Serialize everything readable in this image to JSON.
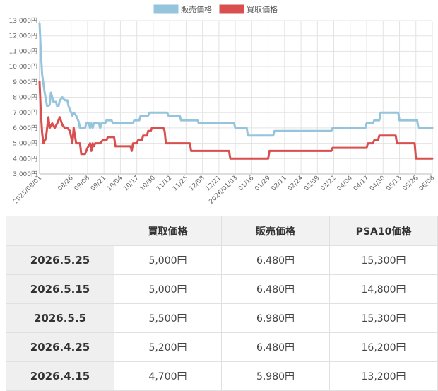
{
  "chart_data": {
    "type": "line",
    "legend_position": "top",
    "x_tick_labels": [
      "2025/08/01",
      "08/26",
      "09/08",
      "09/21",
      "10/04",
      "10/17",
      "10/30",
      "11/12",
      "11/25",
      "12/08",
      "12/21",
      "2026/01/03",
      "01/16",
      "01/29",
      "02/11",
      "02/24",
      "03/09",
      "03/22",
      "04/04",
      "04/17",
      "04/30",
      "05/13",
      "05/26",
      "06/08"
    ],
    "ylim": [
      3000,
      13000
    ],
    "y_ticks": [
      3000,
      4000,
      5000,
      6000,
      7000,
      8000,
      9000,
      10000,
      11000,
      12000,
      13000
    ],
    "y_tick_labels": [
      "3,000円",
      "4,000円",
      "5,000円",
      "6,000円",
      "7,000円",
      "8,000円",
      "9,000円",
      "10,000円",
      "11,000円",
      "12,000円",
      "13,000円"
    ],
    "grid": true,
    "series": [
      {
        "name": "販売価格",
        "color": "#95c4dd",
        "points": [
          [
            "2025-08-01",
            12800
          ],
          [
            "2025-08-02",
            11000
          ],
          [
            "2025-08-03",
            9500
          ],
          [
            "2025-08-05",
            8300
          ],
          [
            "2025-08-07",
            7400
          ],
          [
            "2025-08-09",
            7500
          ],
          [
            "2025-08-10",
            8300
          ],
          [
            "2025-08-12",
            7700
          ],
          [
            "2025-08-14",
            7700
          ],
          [
            "2025-08-15",
            7400
          ],
          [
            "2025-08-16",
            7400
          ],
          [
            "2025-08-17",
            7800
          ],
          [
            "2025-08-19",
            8000
          ],
          [
            "2025-08-21",
            7800
          ],
          [
            "2025-08-23",
            7800
          ],
          [
            "2025-08-24",
            7400
          ],
          [
            "2025-08-26",
            7000
          ],
          [
            "2025-08-27",
            6800
          ],
          [
            "2025-08-28",
            7000
          ],
          [
            "2025-08-30",
            6800
          ],
          [
            "2025-09-01",
            6400
          ],
          [
            "2025-09-02",
            6000
          ],
          [
            "2025-09-06",
            6000
          ],
          [
            "2025-09-07",
            6300
          ],
          [
            "2025-09-09",
            6300
          ],
          [
            "2025-09-10",
            6000
          ],
          [
            "2025-09-11",
            6300
          ],
          [
            "2025-09-12",
            6000
          ],
          [
            "2025-09-13",
            6300
          ],
          [
            "2025-09-17",
            6300
          ],
          [
            "2025-09-18",
            6000
          ],
          [
            "2025-09-19",
            6300
          ],
          [
            "2025-09-22",
            6300
          ],
          [
            "2025-09-23",
            6500
          ],
          [
            "2025-09-27",
            6500
          ],
          [
            "2025-09-28",
            6300
          ],
          [
            "2025-10-14",
            6300
          ],
          [
            "2025-10-15",
            6500
          ],
          [
            "2025-10-19",
            6500
          ],
          [
            "2025-10-20",
            6800
          ],
          [
            "2025-10-26",
            6800
          ],
          [
            "2025-10-27",
            7000
          ],
          [
            "2025-11-10",
            7000
          ],
          [
            "2025-11-11",
            6800
          ],
          [
            "2025-11-20",
            6800
          ],
          [
            "2025-11-21",
            6500
          ],
          [
            "2025-12-04",
            6500
          ],
          [
            "2025-12-05",
            6300
          ],
          [
            "2026-01-02",
            6300
          ],
          [
            "2026-01-03",
            6000
          ],
          [
            "2026-01-12",
            6000
          ],
          [
            "2026-01-13",
            5500
          ],
          [
            "2026-02-02",
            5500
          ],
          [
            "2026-02-03",
            5800
          ],
          [
            "2026-03-20",
            5800
          ],
          [
            "2026-03-21",
            6000
          ],
          [
            "2026-04-16",
            6000
          ],
          [
            "2026-04-17",
            6300
          ],
          [
            "2026-04-22",
            6300
          ],
          [
            "2026-04-23",
            6500
          ],
          [
            "2026-04-27",
            6500
          ],
          [
            "2026-04-28",
            7000
          ],
          [
            "2026-05-12",
            7000
          ],
          [
            "2026-05-13",
            6500
          ],
          [
            "2026-05-27",
            6500
          ],
          [
            "2026-05-28",
            6000
          ],
          [
            "2026-06-08",
            6000
          ]
        ]
      },
      {
        "name": "買取価格",
        "color": "#d94f4f",
        "points": [
          [
            "2025-08-01",
            9000
          ],
          [
            "2025-08-02",
            7000
          ],
          [
            "2025-08-03",
            5700
          ],
          [
            "2025-08-04",
            5000
          ],
          [
            "2025-08-06",
            5300
          ],
          [
            "2025-08-08",
            6700
          ],
          [
            "2025-08-09",
            6000
          ],
          [
            "2025-08-11",
            6300
          ],
          [
            "2025-08-13",
            6000
          ],
          [
            "2025-08-15",
            6300
          ],
          [
            "2025-08-17",
            6700
          ],
          [
            "2025-08-19",
            6200
          ],
          [
            "2025-08-21",
            6000
          ],
          [
            "2025-08-23",
            6000
          ],
          [
            "2025-08-25",
            5800
          ],
          [
            "2025-08-27",
            5000
          ],
          [
            "2025-08-28",
            6000
          ],
          [
            "2025-08-30",
            5000
          ],
          [
            "2025-09-02",
            5000
          ],
          [
            "2025-09-03",
            4300
          ],
          [
            "2025-09-06",
            4300
          ],
          [
            "2025-09-08",
            4700
          ],
          [
            "2025-09-10",
            5000
          ],
          [
            "2025-09-11",
            4500
          ],
          [
            "2025-09-12",
            5000
          ],
          [
            "2025-09-13",
            4800
          ],
          [
            "2025-09-14",
            5000
          ],
          [
            "2025-09-18",
            5000
          ],
          [
            "2025-09-20",
            5200
          ],
          [
            "2025-09-23",
            5200
          ],
          [
            "2025-09-24",
            5400
          ],
          [
            "2025-09-29",
            5400
          ],
          [
            "2025-09-30",
            4800
          ],
          [
            "2025-10-12",
            4800
          ],
          [
            "2025-10-13",
            4500
          ],
          [
            "2025-10-14",
            5000
          ],
          [
            "2025-10-17",
            5000
          ],
          [
            "2025-10-18",
            5200
          ],
          [
            "2025-10-21",
            5200
          ],
          [
            "2025-10-22",
            5500
          ],
          [
            "2025-10-25",
            5500
          ],
          [
            "2025-10-26",
            5800
          ],
          [
            "2025-10-28",
            5800
          ],
          [
            "2025-10-29",
            6000
          ],
          [
            "2025-11-07",
            6000
          ],
          [
            "2025-11-08",
            5800
          ],
          [
            "2025-11-09",
            5000
          ],
          [
            "2025-11-28",
            5000
          ],
          [
            "2025-11-29",
            4500
          ],
          [
            "2025-12-29",
            4500
          ],
          [
            "2025-12-30",
            4000
          ],
          [
            "2026-01-29",
            4000
          ],
          [
            "2026-01-30",
            4500
          ],
          [
            "2026-03-20",
            4500
          ],
          [
            "2026-03-21",
            4700
          ],
          [
            "2026-04-17",
            4700
          ],
          [
            "2026-04-18",
            5000
          ],
          [
            "2026-04-22",
            5000
          ],
          [
            "2026-04-23",
            5200
          ],
          [
            "2026-04-26",
            5200
          ],
          [
            "2026-04-27",
            5500
          ],
          [
            "2026-05-10",
            5500
          ],
          [
            "2026-05-11",
            5000
          ],
          [
            "2026-05-25",
            5000
          ],
          [
            "2026-05-26",
            4000
          ],
          [
            "2026-06-08",
            4000
          ]
        ]
      }
    ]
  },
  "table": {
    "headers": [
      "",
      "買取価格",
      "販売価格",
      "PSA10価格"
    ],
    "rows": [
      {
        "date": "2026.5.25",
        "buy": "5,000円",
        "sell": "6,480円",
        "psa10": "15,300円"
      },
      {
        "date": "2026.5.15",
        "buy": "5,000円",
        "sell": "6,480円",
        "psa10": "14,800円"
      },
      {
        "date": "2026.5.5",
        "buy": "5,500円",
        "sell": "6,980円",
        "psa10": "15,300円"
      },
      {
        "date": "2026.4.25",
        "buy": "5,200円",
        "sell": "6,480円",
        "psa10": "16,200円"
      },
      {
        "date": "2026.4.15",
        "buy": "4,700円",
        "sell": "5,980円",
        "psa10": "13,200円"
      }
    ]
  }
}
